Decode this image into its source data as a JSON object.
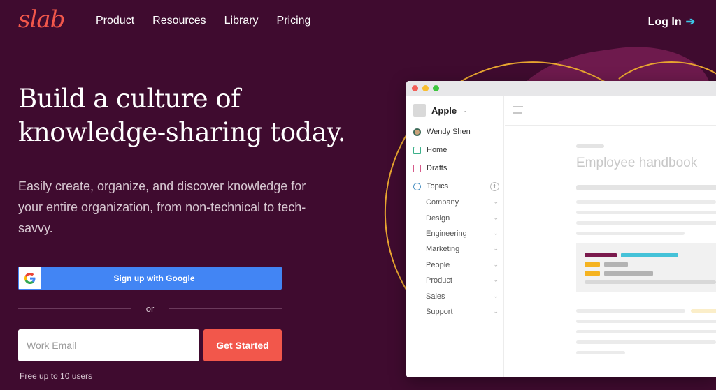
{
  "brand": {
    "logo": "slab"
  },
  "nav": {
    "items": [
      "Product",
      "Resources",
      "Library",
      "Pricing"
    ],
    "login": "Log In"
  },
  "hero": {
    "headline": "Build a culture of knowledge-sharing today.",
    "subtext": "Easily create, organize, and discover knowledge for your entire organization, from non-technical to tech-savvy.",
    "google_button": "Sign up with Google",
    "or": "or",
    "email_placeholder": "Work Email",
    "cta": "Get Started",
    "note": "Free up to 10 users"
  },
  "mockup": {
    "workspace": "Apple",
    "user": "Wendy Shen",
    "home": "Home",
    "drafts": "Drafts",
    "topics": "Topics",
    "topic_list": [
      "Company",
      "Design",
      "Engineering",
      "Marketing",
      "People",
      "Product",
      "Sales",
      "Support"
    ],
    "doc_title": "Employee handbook"
  },
  "colors": {
    "background": "#3f0b2f",
    "accent": "#f2574b",
    "google_blue": "#4285f4",
    "link_arrow": "#3cc6e6"
  }
}
